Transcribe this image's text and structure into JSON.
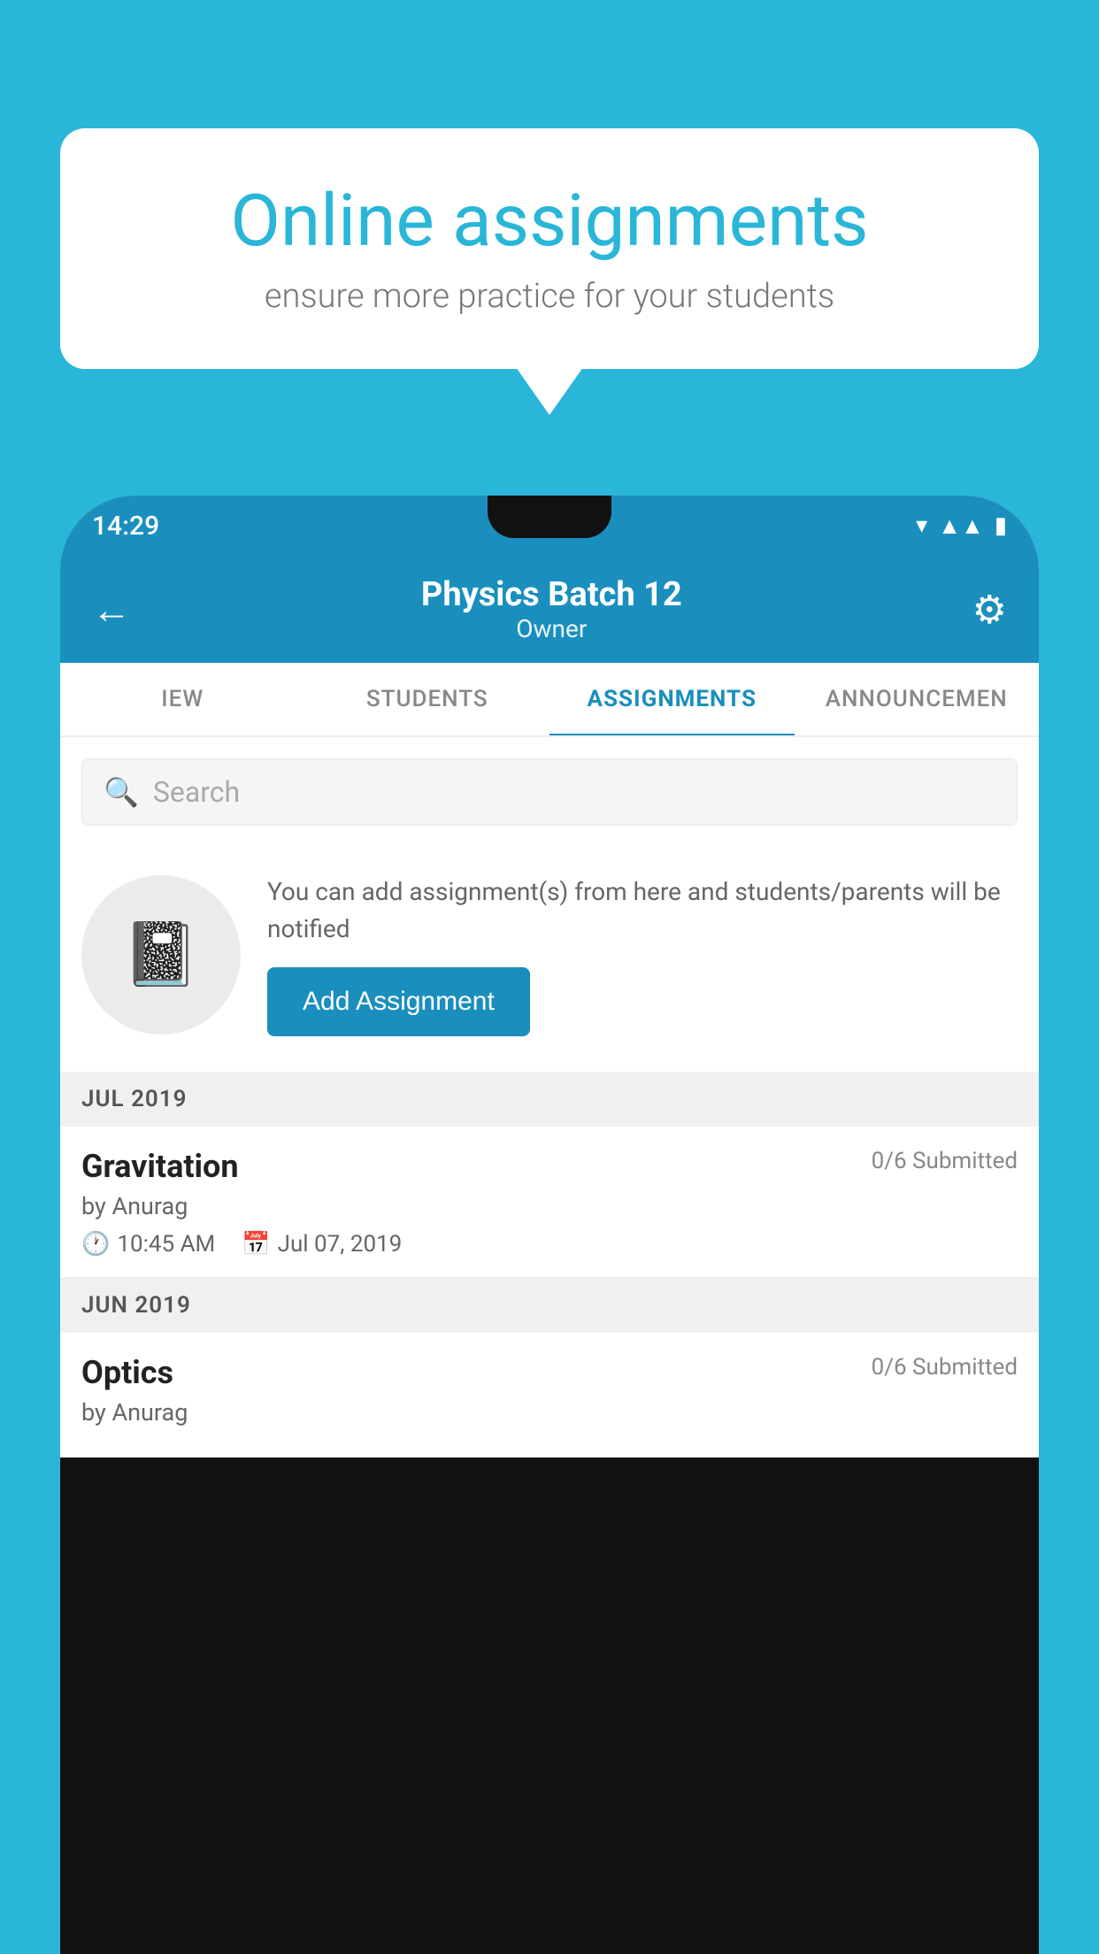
{
  "background_color": "#29b6d8",
  "bubble": {
    "title": "Online assignments",
    "subtitle": "ensure more practice for your students"
  },
  "status_bar": {
    "time": "14:29",
    "icons": [
      "wifi",
      "signal",
      "battery"
    ]
  },
  "header": {
    "title": "Physics Batch 12",
    "subtitle": "Owner"
  },
  "tabs": [
    {
      "label": "IEW",
      "active": false
    },
    {
      "label": "STUDENTS",
      "active": false
    },
    {
      "label": "ASSIGNMENTS",
      "active": true
    },
    {
      "label": "ANNOUNCEM…",
      "active": false
    }
  ],
  "search": {
    "placeholder": "Search"
  },
  "empty_state": {
    "description": "You can add assignment(s) from here and students/parents will be notified",
    "button_label": "Add Assignment"
  },
  "sections": [
    {
      "label": "JUL 2019",
      "assignments": [
        {
          "name": "Gravitation",
          "submitted": "0/6 Submitted",
          "by": "by Anurag",
          "time": "10:45 AM",
          "date": "Jul 07, 2019"
        }
      ]
    },
    {
      "label": "JUN 2019",
      "assignments": [
        {
          "name": "Optics",
          "submitted": "0/6 Submitted",
          "by": "by Anurag",
          "time": "",
          "date": ""
        }
      ]
    }
  ]
}
